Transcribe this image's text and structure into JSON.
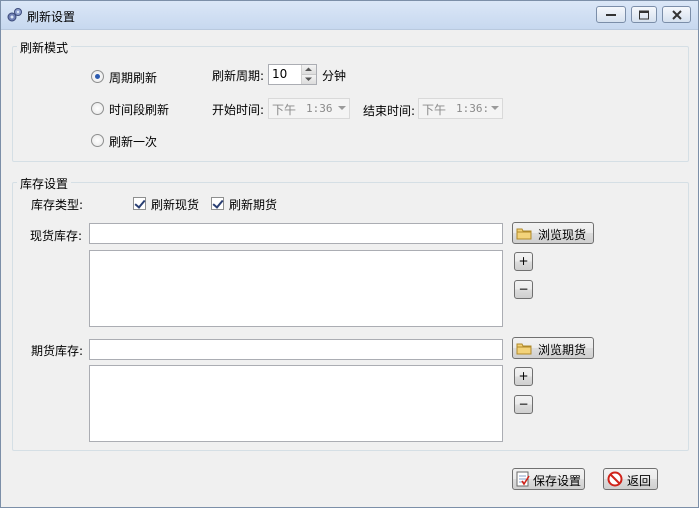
{
  "window": {
    "title": "刷新设置"
  },
  "refresh_mode": {
    "group_title": "刷新模式",
    "radios": [
      {
        "label": "周期刷新",
        "checked": true
      },
      {
        "label": "时间段刷新",
        "checked": false
      },
      {
        "label": "刷新一次",
        "checked": false
      }
    ],
    "period_label": "刷新周期:",
    "period_value": "10",
    "period_unit": "分钟",
    "start_label": "开始时间:",
    "start_ampm": "下午",
    "start_time": "1:36",
    "end_label": "结束时间:",
    "end_ampm": "下午",
    "end_time": "1:36:"
  },
  "inventory": {
    "group_title": "库存设置",
    "type_label": "库存类型:",
    "checkboxes": [
      {
        "label": "刷新现货",
        "checked": true
      },
      {
        "label": "刷新期货",
        "checked": true
      }
    ],
    "spot_label": "现货库存:",
    "spot_value": "",
    "browse_spot": "浏览现货",
    "futures_label": "期货库存:",
    "futures_value": "",
    "browse_futures": "浏览期货",
    "add_label": "+",
    "remove_label": "−"
  },
  "footer": {
    "save_label": "保存设置",
    "back_label": "返回"
  },
  "colors": {
    "titlebar": "#c7d8ef",
    "radio_dot": "#2c5bb0",
    "cancel_icon": "#d0231a",
    "folder": "#e8c25a"
  }
}
